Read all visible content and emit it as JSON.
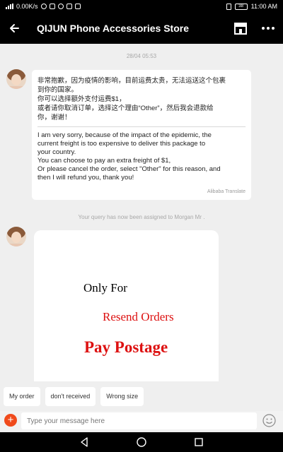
{
  "status_bar": {
    "network_speed": "0.00K/s",
    "battery_level": "38",
    "time": "11:00 AM"
  },
  "header": {
    "title": "QIJUN Phone Accessories Store"
  },
  "chat": {
    "timestamp": "28/04 05:53",
    "message": {
      "chinese_lines": [
        "非常抱歉，因为疫情的影响，目前运费太贵，无法运送这个包裹",
        "到你的国家。",
        "你可以选择额外支付运费$1，",
        "或者请你取消订单，选择这个理由“Other”，然后我会退款给",
        "你，谢谢！"
      ],
      "english_lines": [
        "I am very sorry, because of the impact of the epidemic, the",
        "current freight is too expensive to deliver this package to",
        "your country.",
        "You can choose to pay an extra freight of $1,",
        "Or please cancel the order, select \"Other\" for this reason, and",
        "then I will refund you, thank you!"
      ],
      "translation_label": "Alibaba Translate"
    },
    "system_note": "Your query has now been assigned to Morgan Mr .",
    "image_message": {
      "line1": "Only For",
      "line2": "Resend Orders",
      "line3": "Pay Postage"
    }
  },
  "quick_replies": [
    "My order",
    "don't received",
    "Wrong size"
  ],
  "input": {
    "placeholder": "Type your message here"
  },
  "colors": {
    "accent": "#f04a1b",
    "image_red": "#dd1111",
    "header_bg": "#000000"
  },
  "icons": {
    "back": "back-arrow-icon",
    "store": "store-icon",
    "more": "more-dots-icon",
    "add": "plus-icon",
    "emoji": "emoji-icon",
    "nav_back": "nav-back-icon",
    "nav_home": "nav-home-icon",
    "nav_recent": "nav-recent-icon"
  }
}
